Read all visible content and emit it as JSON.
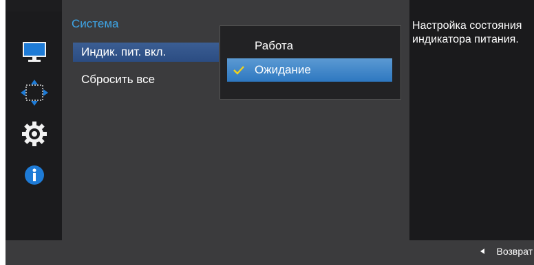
{
  "menu": {
    "title": "Система",
    "items": [
      {
        "label": "Индик. пит. вкл."
      },
      {
        "label": "Сбросить все"
      }
    ]
  },
  "submenu": {
    "options": [
      {
        "label": "Работа"
      },
      {
        "label": "Ожидание"
      }
    ]
  },
  "help": {
    "text": "Настройка состояния индикатора питания."
  },
  "footer": {
    "back_label": "Возврат"
  },
  "icons": [
    "monitor-icon",
    "resize-arrows-icon",
    "gear-icon",
    "info-icon"
  ],
  "colors": {
    "accent": "#3ea6e8",
    "highlight": "#2e78c0",
    "check": "#f2d21b"
  }
}
